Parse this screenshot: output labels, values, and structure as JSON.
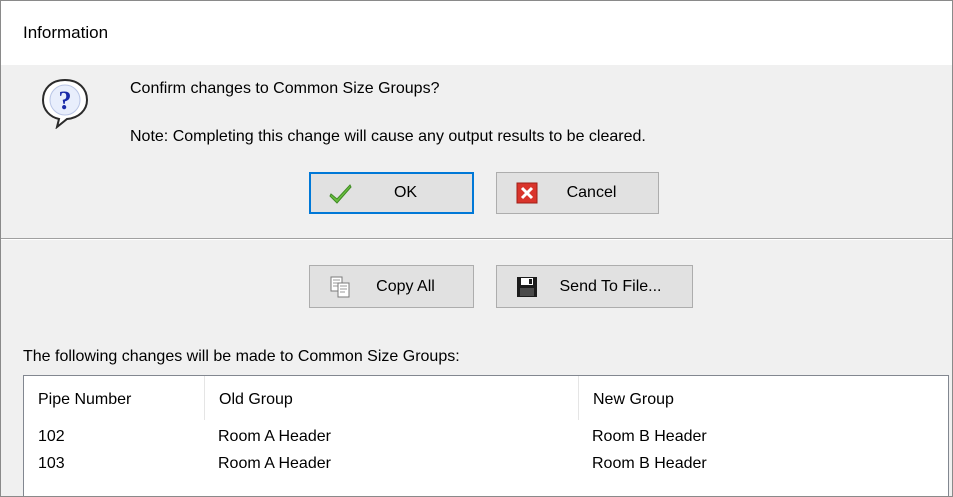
{
  "window": {
    "title": "Information"
  },
  "message": {
    "icon": "question-icon",
    "line1": "Confirm changes to Common Size Groups?",
    "line2": "Note: Completing this change will cause any output results to be cleared."
  },
  "buttons": {
    "ok": {
      "label": "OK",
      "icon": "checkmark-icon"
    },
    "cancel": {
      "label": "Cancel",
      "icon": "red-x-icon"
    },
    "copy_all": {
      "label": "Copy All",
      "icon": "copy-icon"
    },
    "send_to_file": {
      "label": "Send To File...",
      "icon": "floppy-disk-icon"
    }
  },
  "changes": {
    "label": "The following changes will be made to Common Size Groups:",
    "columns": [
      "Pipe Number",
      "Old Group",
      "New Group"
    ],
    "rows": [
      [
        "102",
        "Room A Header",
        "Room B Header"
      ],
      [
        "103",
        "Room A Header",
        "Room B Header"
      ]
    ]
  },
  "colors": {
    "accent": "#0078d7",
    "check_green": "#6abf3f",
    "cancel_red": "#d9342b"
  }
}
